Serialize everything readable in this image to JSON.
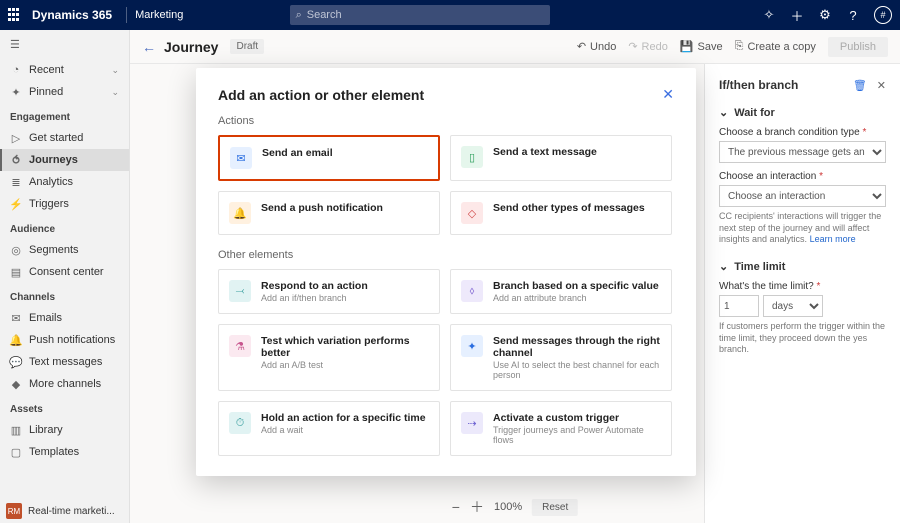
{
  "topbar": {
    "product": "Dynamics 365",
    "module": "Marketing",
    "search_placeholder": "Search",
    "avatar_initial": "#"
  },
  "sidebar": {
    "recent": "Recent",
    "pinned": "Pinned",
    "sections": {
      "engagement": "Engagement",
      "audience": "Audience",
      "channels": "Channels",
      "assets": "Assets"
    },
    "items": {
      "get_started": "Get started",
      "journeys": "Journeys",
      "analytics": "Analytics",
      "triggers": "Triggers",
      "segments": "Segments",
      "consent": "Consent center",
      "emails": "Emails",
      "push": "Push notifications",
      "text": "Text messages",
      "more": "More channels",
      "library": "Library",
      "templates": "Templates"
    },
    "profile": {
      "abbr": "RM",
      "label": "Real-time marketi..."
    }
  },
  "cmdbar": {
    "title": "Journey",
    "badge": "Draft",
    "undo": "Undo",
    "redo": "Redo",
    "save": "Save",
    "copy": "Create a copy",
    "publish": "Publish"
  },
  "modal": {
    "title": "Add an action or other element",
    "group_actions": "Actions",
    "group_other": "Other elements",
    "actions": {
      "email": "Send an email",
      "text": "Send a text message",
      "push": "Send a push notification",
      "other": "Send other types of messages"
    },
    "other": {
      "respond": {
        "t": "Respond to an action",
        "s": "Add an if/then branch"
      },
      "branch": {
        "t": "Branch based on a specific value",
        "s": "Add an attribute branch"
      },
      "test": {
        "t": "Test which variation performs better",
        "s": "Add an A/B test"
      },
      "channel": {
        "t": "Send messages through the right channel",
        "s": "Use AI to select the best channel for each person"
      },
      "hold": {
        "t": "Hold an action for a specific time",
        "s": "Add a wait"
      },
      "trigger": {
        "t": "Activate a custom trigger",
        "s": "Trigger journeys and Power Automate flows"
      }
    }
  },
  "rpanel": {
    "title": "If/then branch",
    "wait_for": "Wait for",
    "label_condition": "Choose a branch condition type",
    "val_condition": "The previous message gets an interacti…",
    "label_interaction": "Choose an interaction",
    "placeholder_interaction": "Choose an interaction",
    "help1": "CC recipients' interactions will trigger the next step of the journey and will affect insights and analytics.",
    "learn_more": "Learn more",
    "time_limit": "Time limit",
    "label_time": "What's the time limit?",
    "time_value": "1",
    "time_unit": "days",
    "help2": "If customers perform the trigger within the time limit, they proceed down the yes branch."
  },
  "zoom": {
    "pct": "100%",
    "reset": "Reset"
  }
}
